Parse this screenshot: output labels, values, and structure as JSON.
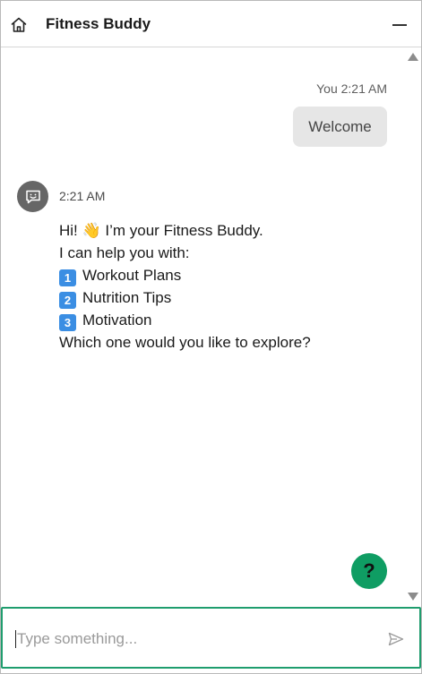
{
  "header": {
    "title": "Fitness Buddy",
    "home_icon": "home-icon",
    "minimize_icon": "minimize-icon"
  },
  "messages": {
    "user": {
      "meta": "You 2:21 AM",
      "text": "Welcome"
    },
    "bot": {
      "avatar_icon": "chat-bot-icon",
      "time": "2:21 AM",
      "greeting": "Hi! 👋 I’m your Fitness Buddy.",
      "intro": "I can help you with:",
      "options": [
        {
          "number": "1",
          "label": "Workout Plans"
        },
        {
          "number": "2",
          "label": "Nutrition Tips"
        },
        {
          "number": "3",
          "label": "Motivation"
        }
      ],
      "question": "Which one would you like to explore?"
    }
  },
  "help_button": {
    "label": "?"
  },
  "composer": {
    "placeholder": "Type something...",
    "send_icon": "send-icon"
  },
  "colors": {
    "accent_green": "#0f9d63",
    "input_border": "#1f9d6e",
    "user_bubble": "#e6e6e6",
    "avatar_bg": "#666666",
    "number_badge": "#3b8ee3"
  }
}
